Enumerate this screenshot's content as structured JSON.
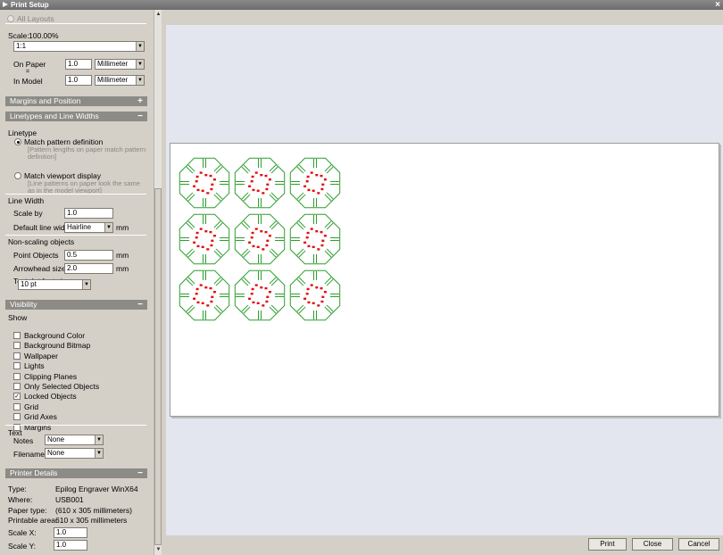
{
  "window": {
    "title": "Print Setup"
  },
  "scale": {
    "all_layouts": "All Layouts",
    "label": "Scale:",
    "value": "100.00%",
    "preset": "1:1",
    "on_paper_label": "On Paper",
    "equals": "=",
    "in_model_label": "In Model",
    "on_paper_value": "1.0",
    "on_paper_unit": "Millimeter",
    "in_model_value": "1.0",
    "in_model_unit": "Millimeter"
  },
  "margins": {
    "title": "Margins and Position",
    "toggle": "+"
  },
  "linetypes": {
    "title": "Linetypes and Line Widths",
    "toggle": "−",
    "linetype_label": "Linetype",
    "match_pattern": "Match pattern definition",
    "match_pattern_help1": "[Pattern lengths on paper match pattern",
    "match_pattern_help2": "definition]",
    "match_viewport": "Match viewport display",
    "match_viewport_help1": "[Line patterns on paper look the same",
    "match_viewport_help2": "as in the model viewport]",
    "line_width_label": "Line Width",
    "scale_by_label": "Scale by",
    "scale_by_value": "1.0",
    "default_width_label": "Default line width",
    "default_width_value": "Hairline",
    "mm": "mm",
    "non_scaling_label": "Non-scaling objects",
    "point_objects_label": "Point Objects",
    "point_objects_value": "0.5",
    "arrowhead_label": "Arrowhead size",
    "arrowhead_value": "2.0",
    "text_dot_label": "Text dot font size",
    "text_dot_value": "10 pt"
  },
  "visibility": {
    "title": "Visibility",
    "toggle": "−",
    "show_label": "Show",
    "items": [
      {
        "label": "Background Color",
        "checked": false
      },
      {
        "label": "Background Bitmap",
        "checked": false
      },
      {
        "label": "Wallpaper",
        "checked": false
      },
      {
        "label": "Lights",
        "checked": false
      },
      {
        "label": "Clipping Planes",
        "checked": false
      },
      {
        "label": "Only Selected Objects",
        "checked": false
      },
      {
        "label": "Locked Objects",
        "checked": true
      },
      {
        "label": "Grid",
        "checked": false
      },
      {
        "label": "Grid Axes",
        "checked": false
      },
      {
        "label": "Margins",
        "checked": false
      }
    ],
    "text_label": "Text",
    "notes_label": "Notes",
    "notes_value": "None",
    "filename_label": "Filename",
    "filename_value": "None"
  },
  "printer": {
    "title": "Printer Details",
    "toggle": "−",
    "type_label": "Type:",
    "type_value": "Epilog Engraver WinX64",
    "where_label": "Where:",
    "where_value": "USB001",
    "paper_label": "Paper type:",
    "paper_value": "(610 x 305 millimeters)",
    "area_label": "Printable area:",
    "area_value": "610 x 305 millimeters",
    "scale_x_label": "Scale X:",
    "scale_x_value": "1.0",
    "scale_y_label": "Scale Y:",
    "scale_y_value": "1.0"
  },
  "buttons": {
    "print": "Print",
    "close": "Close",
    "cancel": "Cancel"
  },
  "colors": {
    "part_outline": "#2e9e2e",
    "engraving": "#e01010"
  },
  "icons": {
    "checked": "✓",
    "dropdown": "▼",
    "scroll_up": "▲",
    "scroll_down": "▼",
    "close": "×"
  }
}
